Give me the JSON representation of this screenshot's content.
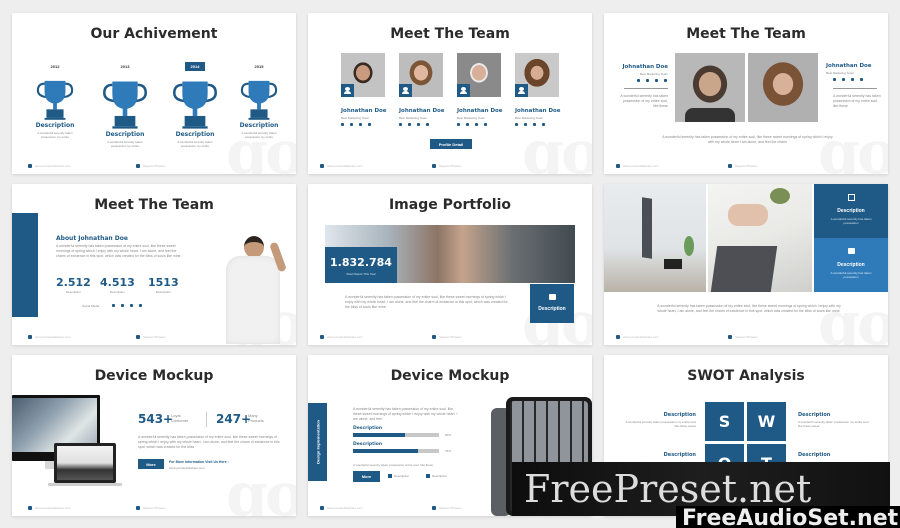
{
  "slides": {
    "achievement": {
      "title": "Our Achivement",
      "items": [
        {
          "year": "2012",
          "label": "Description",
          "text": "A wonderful serenity taken possession my entire",
          "active": false
        },
        {
          "year": "2013",
          "label": "Description",
          "text": "A wonderful serenity taken possession my entire",
          "active": false
        },
        {
          "year": "2014",
          "label": "Description",
          "text": "A wonderful serenity taken possession my entire",
          "active": true
        },
        {
          "year": "2015",
          "label": "Description",
          "text": "A wonderful serenity taken possession my entire",
          "active": false
        }
      ]
    },
    "team1": {
      "title": "Meet The Team",
      "members": [
        {
          "name": "Johnathan Doe",
          "role": "Best Marketing Team"
        },
        {
          "name": "Johnathan Doe",
          "role": "Best Marketing Team"
        },
        {
          "name": "Johnathan Doe",
          "role": "Best Marketing Team"
        },
        {
          "name": "Johnathan Doe",
          "role": "Best Marketing Team"
        }
      ],
      "button": "Profile Detail"
    },
    "team2": {
      "title": "Meet The Team",
      "left": {
        "name": "Johnathan Doe",
        "role": "Best Marketing Team",
        "text": "A wonderful serenity has taken possession of my entire soul, like these"
      },
      "right": {
        "name": "Johnathan Doe",
        "role": "Best Marketing Team",
        "text": "A wonderful serenity has taken possession of my entire soul, like these"
      },
      "body": "A wonderful serenity has taken possession of my entire soul, like these sweet mornings of spring which I enjoy with my whole heart I am alone, and feel the charm"
    },
    "team3": {
      "title": "Meet The Team",
      "heading": "About Johnathan Doe",
      "body": "A wonderful serenity has taken possession of my entire soul, like these sweet mornings of spring which I enjoy with my whole heart. I am alone, and feel the charm of existence in this spot, which was created for the bliss of souls like mine.",
      "stats": [
        {
          "value": "2.512",
          "label": "Description"
        },
        {
          "value": "4.513",
          "label": "Description"
        },
        {
          "value": "1513",
          "label": "Description"
        }
      ],
      "social_label": "Social Media"
    },
    "portfolio": {
      "title": "Image Portfolio",
      "stat_value": "1.832.784",
      "stat_label": "Total Clients This Year",
      "body": "A wonderful serenity has taken possession of my entire soul, like these sweet mornings of spring which I enjoy with my whole heart. I am alone, and feel the charm of existence in this spot, which was created for the bliss of souls like mine.",
      "card_label": "Description"
    },
    "photo_desc": {
      "cards": [
        {
          "label": "Description",
          "text": "A wonderful serenity has taken possession"
        },
        {
          "label": "Description",
          "text": "A wonderful serenity has taken possession"
        }
      ],
      "body": "A wonderful serenity has taken possession of my entire soul, like these sweet mornings of spring which I enjoy with my whole heart, I am alone, and feel the charm of existence in this spot, which was created for the bliss of souls like mine."
    },
    "device1": {
      "title": "Device Mockup",
      "stat1_value": "543+",
      "stat1_label": "Loyal Customer",
      "stat2_value": "247+",
      "stat2_label": "Many Products",
      "body": "A wonderful serenity has taken possession of my entire soul, like these sweet mornings of spring which I enjoy with my whole heart, I am alone, and feel the charm of existence in this spot, which was created for the bliss",
      "button": "More",
      "info_heading": "For More Information Visit Us Here :",
      "info_url": "www.yourwebsitehere.com"
    },
    "device2": {
      "title": "Device Mockup",
      "side_label": "Design Implementation",
      "body": "A wonderful serenity has taken possession of my entire soul, like these sweet mornings of spring which I enjoy with my whole heart. I am alone, and feel",
      "bars": [
        {
          "label": "Description",
          "value": 60,
          "pct": "60%"
        },
        {
          "label": "Description",
          "value": 75,
          "pct": "75%"
        }
      ],
      "note": "A wonderful serenity taken possession entire soul, like these",
      "button": "More",
      "links": [
        "Description",
        "Description"
      ]
    },
    "swot": {
      "title": "SWOT Analysis",
      "letters": [
        "S",
        "W",
        "O",
        "T"
      ],
      "items": [
        {
          "label": "Description",
          "text": "A wonderful serenity taken possession my entire soul like these sweet"
        },
        {
          "label": "Description",
          "text": "A wonderful serenity taken possession my entire soul like these sweet"
        },
        {
          "label": "Description",
          "text": ""
        },
        {
          "label": "Description",
          "text": ""
        }
      ]
    }
  },
  "watermark": {
    "line1": "FreePreset.net",
    "line2": "FreeAudioSet.net"
  },
  "footer": {
    "left": "www.yourwebsitehere.com",
    "right": "Support Phrases"
  },
  "colors": {
    "primary": "#1f5a86",
    "secondary": "#2f7ab8",
    "title": "#2b2b2b"
  }
}
